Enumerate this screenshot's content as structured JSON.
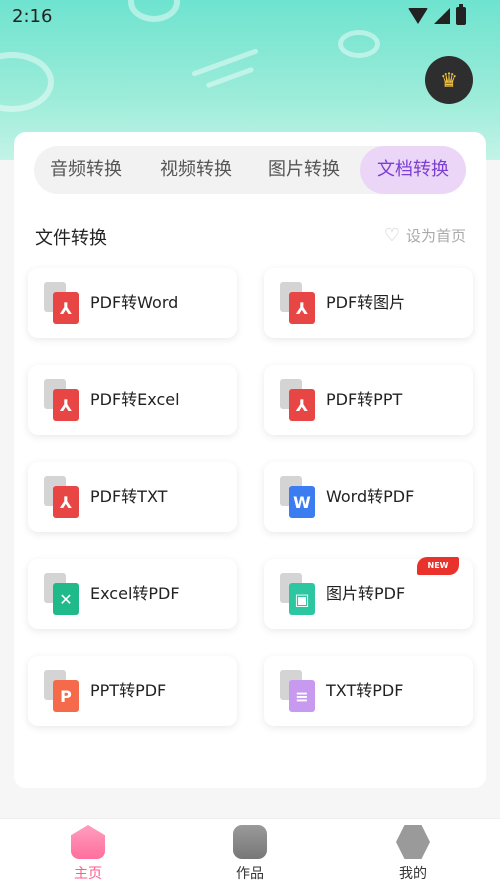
{
  "status_bar": {
    "time": "2:16"
  },
  "tabs": [
    {
      "label": "音频转换"
    },
    {
      "label": "视频转换"
    },
    {
      "label": "图片转换"
    },
    {
      "label": "文档转换",
      "active": true
    }
  ],
  "section": {
    "title": "文件转换",
    "set_home_label": "设为首页"
  },
  "tools": [
    {
      "label": "PDF转Word",
      "icon": "pdf-icon",
      "color": "#e84545"
    },
    {
      "label": "PDF转图片",
      "icon": "pdf-icon",
      "color": "#e84545"
    },
    {
      "label": "PDF转Excel",
      "icon": "pdf-icon",
      "color": "#e84545"
    },
    {
      "label": "PDF转PPT",
      "icon": "pdf-icon",
      "color": "#e84545"
    },
    {
      "label": "PDF转TXT",
      "icon": "pdf-icon",
      "color": "#e84545"
    },
    {
      "label": "Word转PDF",
      "icon": "word-icon",
      "color": "#3b7cf0"
    },
    {
      "label": "Excel转PDF",
      "icon": "excel-icon",
      "color": "#1fb98a"
    },
    {
      "label": "图片转PDF",
      "icon": "image-icon",
      "color": "#2cc7a0",
      "badge": "NEW"
    },
    {
      "label": "PPT转PDF",
      "icon": "ppt-icon",
      "color": "#f56a4a"
    },
    {
      "label": "TXT转PDF",
      "icon": "txt-icon",
      "color": "#c79af0"
    }
  ],
  "bottom_nav": [
    {
      "label": "主页"
    },
    {
      "label": "作品"
    },
    {
      "label": "我的"
    }
  ],
  "colors": {
    "accent": "#7b3fd0",
    "active_tab_bg": "#ecd6f8",
    "header": "#6ee3cf",
    "nav_active": "#ff5b8f"
  }
}
